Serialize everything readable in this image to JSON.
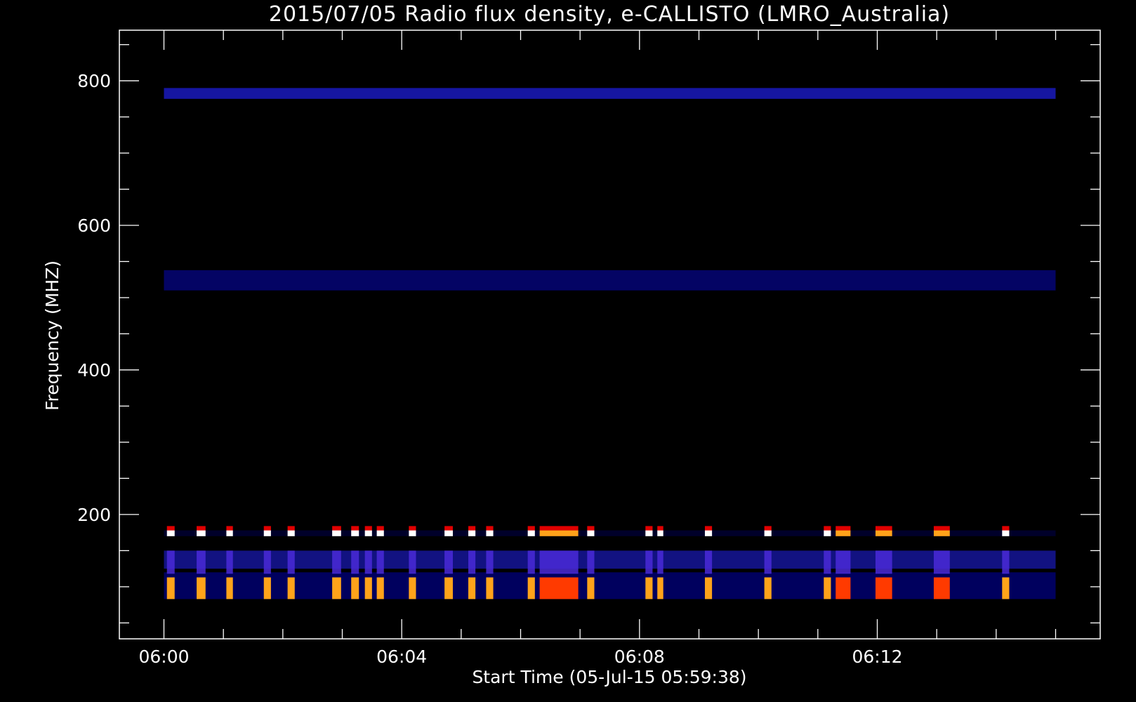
{
  "chart_data": {
    "type": "heatmap",
    "title": "2015/07/05  Radio flux density, e-CALLISTO (LMRO_Australia)",
    "xlabel": "Start Time (05-Jul-15 05:59:38)",
    "ylabel": "Frequency (MHZ)",
    "x_ticks": [
      "06:00",
      "06:04",
      "06:08",
      "06:12"
    ],
    "x_tick_minutes": [
      0,
      4,
      8,
      12
    ],
    "x_range_minutes": [
      -0.75,
      15.75
    ],
    "data_x_range_minutes": [
      0,
      15
    ],
    "y_ticks": [
      200,
      400,
      600,
      800
    ],
    "y_range_mhz": [
      870,
      28
    ],
    "data_y_range_mhz": [
      850,
      45
    ],
    "y_reversed": true,
    "colormap": [
      "#000000",
      "#0000b4",
      "#1e1ed7",
      "#ff2a00",
      "#ffa31a",
      "#ffffff"
    ],
    "background_color": "#0b0bbf",
    "rfi_bursts": {
      "band_mhz": [
        83,
        113
      ],
      "marker_band_mhz": [
        170,
        178
      ],
      "burst_start_minutes": [
        0.05,
        0.55,
        1.05,
        1.68,
        2.08,
        2.83,
        3.15,
        3.38,
        3.58,
        4.12,
        4.72,
        5.12,
        5.42,
        6.12,
        6.32,
        7.12,
        8.1,
        8.3,
        9.1,
        10.1,
        11.1,
        11.3,
        11.97,
        12.95,
        14.1
      ],
      "burst_end_minutes": [
        0.18,
        0.7,
        1.16,
        1.8,
        2.2,
        2.98,
        3.28,
        3.5,
        3.7,
        4.24,
        4.86,
        5.24,
        5.54,
        6.24,
        6.97,
        7.24,
        8.22,
        8.4,
        9.22,
        10.22,
        11.22,
        11.55,
        12.25,
        13.22,
        14.22
      ]
    }
  }
}
